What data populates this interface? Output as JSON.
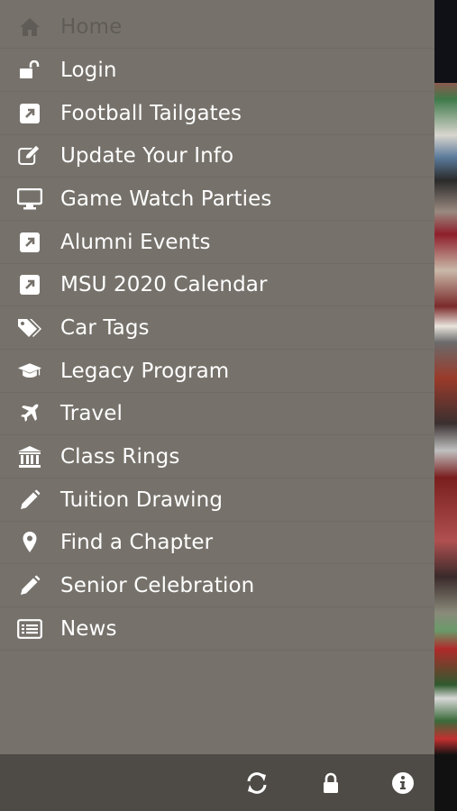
{
  "menu": {
    "items": [
      {
        "label": "Home",
        "icon": "home-icon",
        "dim": true
      },
      {
        "label": "Login",
        "icon": "unlock-icon"
      },
      {
        "label": "Football Tailgates",
        "icon": "external-link-icon"
      },
      {
        "label": "Update Your Info",
        "icon": "edit-icon"
      },
      {
        "label": "Game Watch Parties",
        "icon": "monitor-icon"
      },
      {
        "label": "Alumni Events",
        "icon": "external-link-icon"
      },
      {
        "label": "MSU 2020 Calendar",
        "icon": "external-link-icon"
      },
      {
        "label": "Car Tags",
        "icon": "tags-icon"
      },
      {
        "label": "Legacy Program",
        "icon": "graduation-cap-icon"
      },
      {
        "label": "Travel",
        "icon": "plane-icon"
      },
      {
        "label": "Class Rings",
        "icon": "bank-icon"
      },
      {
        "label": "Tuition Drawing",
        "icon": "pencil-icon"
      },
      {
        "label": "Find a Chapter",
        "icon": "map-marker-icon"
      },
      {
        "label": "Senior Celebration",
        "icon": "pencil-icon"
      },
      {
        "label": "News",
        "icon": "list-alt-icon"
      }
    ]
  },
  "footer": {
    "icons": [
      "refresh-icon",
      "lock-icon",
      "info-icon"
    ]
  },
  "colors": {
    "drawer": "#76726b",
    "footer": "#4e4b47",
    "text": "#ffffff",
    "dim_text": "#5f5c57"
  }
}
